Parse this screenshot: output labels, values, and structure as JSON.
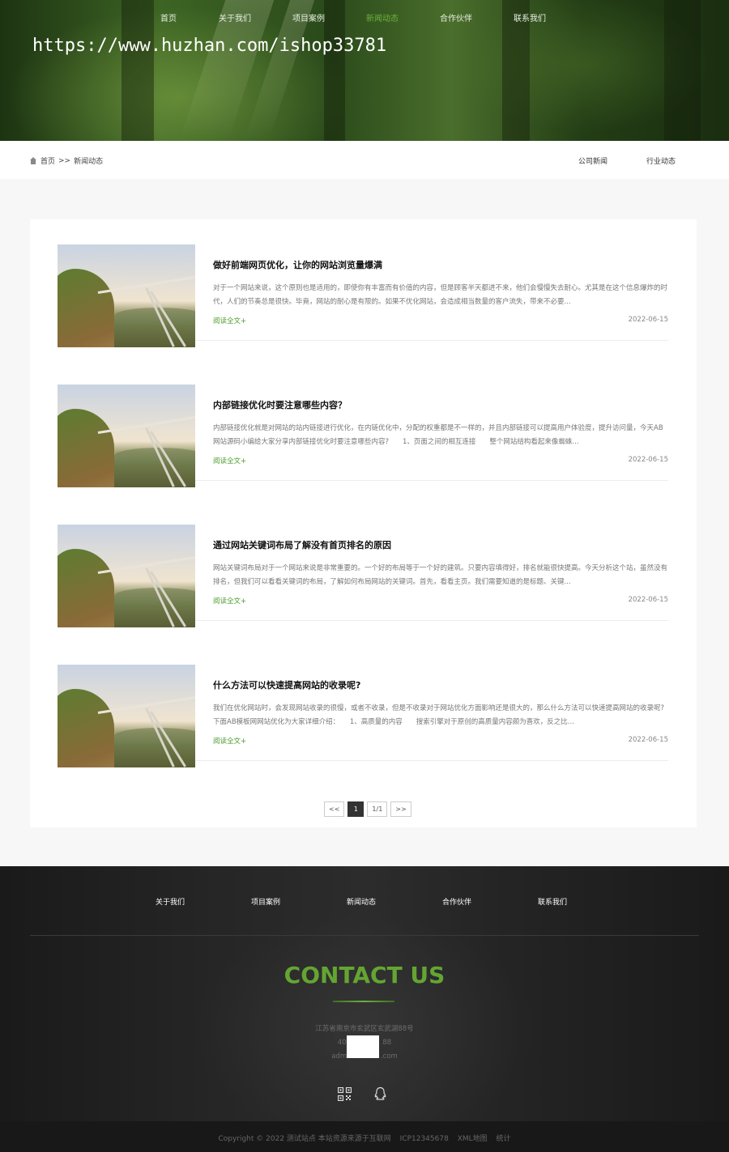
{
  "nav": {
    "items": [
      {
        "label": "首页",
        "active": false
      },
      {
        "label": "关于我们",
        "active": false
      },
      {
        "label": "项目案例",
        "active": false
      },
      {
        "label": "新闻动态",
        "active": true
      },
      {
        "label": "合作伙伴",
        "active": false
      },
      {
        "label": "联系我们",
        "active": false
      }
    ]
  },
  "watermark": "https://www.huzhan.com/ishop33781",
  "breadcrumb": {
    "home": "首页",
    "separator": ">>",
    "current": "新闻动态"
  },
  "subnav": [
    "公司新闻",
    "行业动态"
  ],
  "news": [
    {
      "title": "做好前端网页优化，让你的网站浏览量爆满",
      "excerpt": "对于一个网站来说，这个原则也是适用的，即使你有丰富而有价值的内容，但是顾客半天都进不来，他们会慢慢失去耐心。尤其是在这个信息爆炸的时代，人们的节奏总是很快。毕竟，网站的耐心是有限的。如果不优化网站，会造成相当数量的客户流失，带来不必要...",
      "more": "阅读全文+",
      "date": "2022-06-15"
    },
    {
      "title": "内部链接优化时要注意哪些内容？",
      "excerpt": "内部链接优化就是对网站的站内链接进行优化，在内链优化中，分配的权重都是不一样的，并且内部链接可以提高用户体验度，提升访问量，今天AB网站源码小编给大家分享内部链接优化时要注意哪些内容?　　1、页面之间的相互连接　　整个网站结构看起来像蜘蛛...",
      "more": "阅读全文+",
      "date": "2022-06-15"
    },
    {
      "title": "通过网站关键词布局了解没有首页排名的原因",
      "excerpt": "网站关键词布局对于一个网站来说是非常重要的。一个好的布局等于一个好的建筑。只要内容填得好，排名就能很快提高。今天分析这个站，虽然没有排名，但我们可以看看关键词的布局，了解如何布局网站的关键词。首先，看看主页。我们需要知道的是标题、关键...",
      "more": "阅读全文+",
      "date": "2022-06-15"
    },
    {
      "title": "什么方法可以快速提高网站的收录呢?",
      "excerpt": "我们在优化网站时，会发现网站收录的很慢，或者不收录，但是不收录对于网站优化方面影响还是很大的，那么什么方法可以快速提高网站的收录呢?下面AB模板网网站优化为大家详细介绍：　　1、高质量的内容　　搜索引擎对于原创的高质量内容颇为喜欢，反之比...",
      "more": "阅读全文+",
      "date": "2022-06-15"
    }
  ],
  "pager": {
    "prev": "<<",
    "current": "1",
    "total": "1/1",
    "next": ">>"
  },
  "footer": {
    "nav": [
      "关于我们",
      "项目案例",
      "新闻动态",
      "合作伙伴",
      "联系我们"
    ],
    "contact_heading": "CONTACT US",
    "address": "江苏省南京市玄武区玄武湖88号",
    "phone": "4008　　　　88",
    "email": "admin　　　　.com",
    "icons": [
      "qrcode-icon",
      "qq-icon"
    ],
    "copyright": [
      "Copyright © 2022 测试站点 本站资源来源于互联网",
      "ICP12345678",
      "XML地图",
      "统计"
    ]
  },
  "colors": {
    "accent": "#6ab23b",
    "contact_heading": "#64a532",
    "footer_bg": "#222222"
  }
}
